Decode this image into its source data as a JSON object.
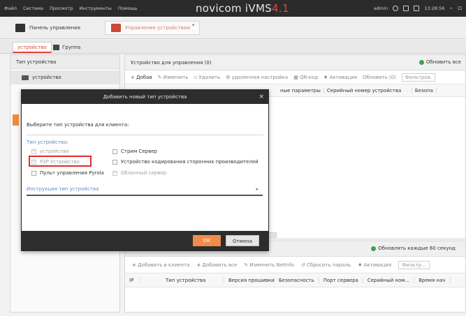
{
  "menu": [
    "Файл",
    "Система",
    "Просмотр",
    "Инструменты",
    "Помощь"
  ],
  "app": {
    "title": "novicom iVMS",
    "version": "4.1"
  },
  "titlebar_right": {
    "user": "admin",
    "time": "13:28:56"
  },
  "modules": {
    "control_panel": "Панель управления",
    "device_management": "Управление устройством"
  },
  "subtabs": {
    "devices": "устройство",
    "group": "Группа"
  },
  "left_panel": {
    "header": "Тип устройства",
    "item": "устройство"
  },
  "right_panel": {
    "header": "Устройство для управления (0)",
    "refresh_all": "Обновить все",
    "toolbar": {
      "add": "Добав",
      "edit": "Изменить",
      "delete": "Удалить",
      "remote": "удаленная настройка",
      "qr": "QR-код",
      "activate": "Активация",
      "refresh": "Обновить (0)",
      "filter": "Фильтров."
    },
    "columns": [
      "ные параметры",
      "Серийный номер устройства",
      "Безопа"
    ]
  },
  "bottom_panel": {
    "refresh60": "Обновлять каждые 60 секунд",
    "toolbar": {
      "add_client": "Добавить в клиента",
      "add_all": "Добавить все",
      "modify_netinfo": "Изменить NetInfo",
      "reset_pwd": "Сбросить пароль",
      "activate": "Активация",
      "filter": "Фильтр..."
    },
    "columns": [
      "IP",
      "Тип устройства",
      "Версия прошивки",
      "Безопасность",
      "Порт сервера",
      "Серийный ном...",
      "Время нач"
    ]
  },
  "modal": {
    "title": "Добавить новый тип устройства",
    "prompt": "Выберите тип устройства для клиента:",
    "type_label": "Тип устройства:",
    "options": {
      "device": "устройство",
      "p2p": "P2P Устройство",
      "remote_control": "Пульт управления Pyrola",
      "stream_server": "Стрим Сервер",
      "encoder": "Устройство кодирования сторонних производителей",
      "cloud_server": "Облачный сервер"
    },
    "instruction": "Инструкция тип устройства",
    "ok": "ОК",
    "cancel": "Отмена"
  }
}
